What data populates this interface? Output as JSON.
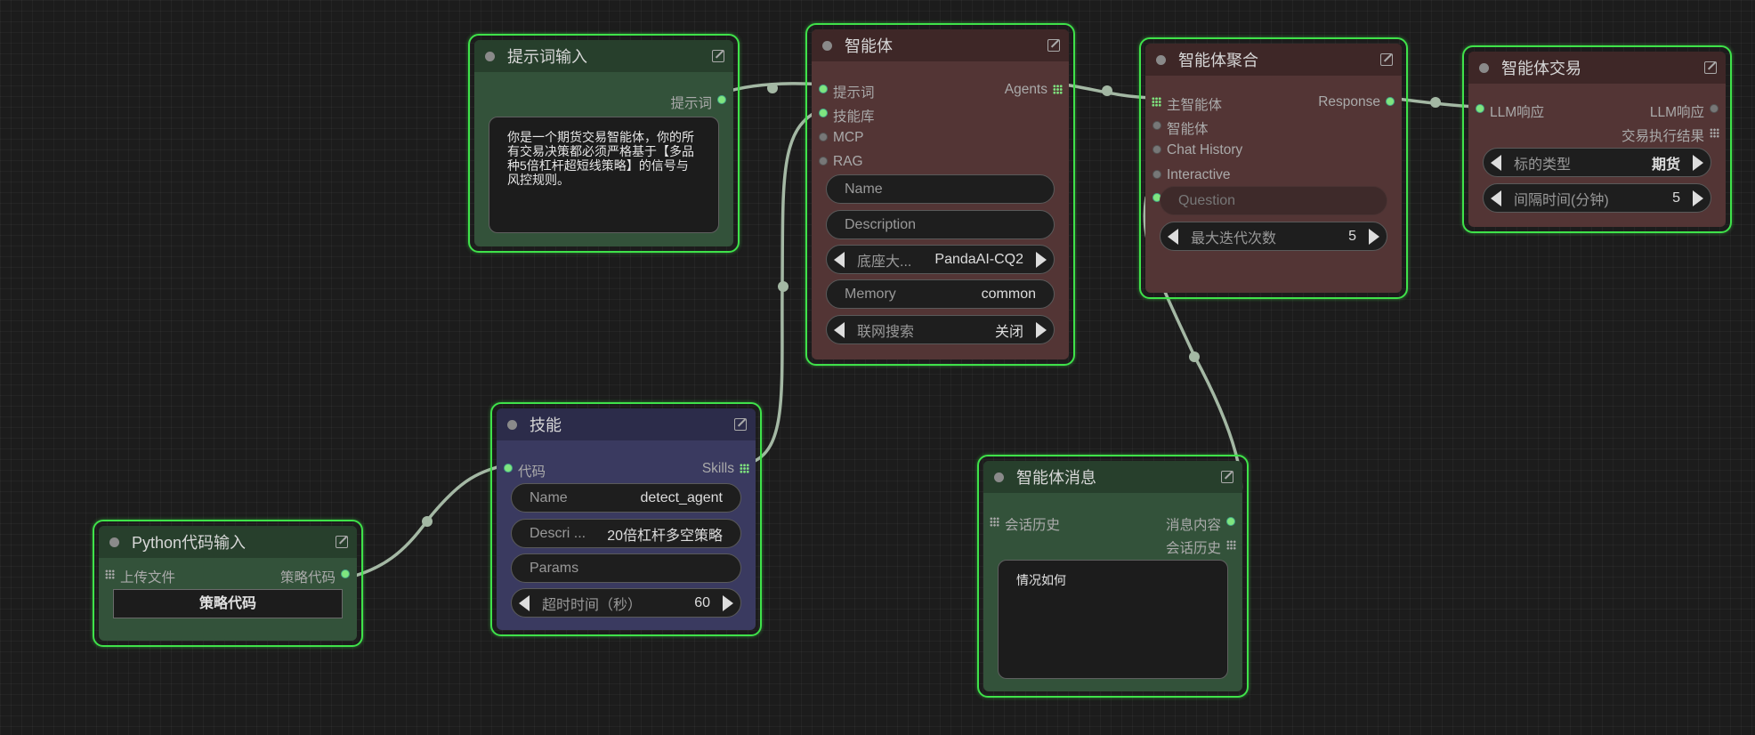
{
  "colors": {
    "accent": "#3fe24a",
    "wire": "#a4b8a4"
  },
  "nodes": {
    "prompt": {
      "title": "提示词输入",
      "output": "提示词",
      "text": "你是一个期货交易智能体，你的所有交易决策都必须严格基于【多品种5倍杠杆超短线策略】的信号与风控规则。"
    },
    "skill": {
      "title": "技能",
      "input": "代码",
      "output": "Skills",
      "name_label": "Name",
      "name_value": "detect_agent",
      "desc_label": "Descri ...",
      "desc_value": "20倍杠杆多空策略",
      "params_label": "Params",
      "timeout_label": "超时时间（秒）",
      "timeout_value": "60"
    },
    "python": {
      "title": "Python代码输入",
      "input": "上传文件",
      "output": "策略代码",
      "button": "策略代码"
    },
    "agent": {
      "title": "智能体",
      "inputs": [
        "提示词",
        "技能库",
        "MCP",
        "RAG"
      ],
      "output": "Agents",
      "name_placeholder": "Name",
      "desc_placeholder": "Description",
      "model_label": "底座大...",
      "model_value": "PandaAI-CQ2",
      "memory_label": "Memory",
      "memory_value": "common",
      "search_label": "联网搜索",
      "search_value": "关闭"
    },
    "aggregate": {
      "title": "智能体聚合",
      "inputs": [
        "主智能体",
        "智能体",
        "Chat History",
        "Interactive"
      ],
      "output": "Response",
      "question_placeholder": "Question",
      "iter_label": "最大迭代次数",
      "iter_value": "5"
    },
    "trade": {
      "title": "智能体交易",
      "input": "LLM响应",
      "outputs": [
        "LLM响应",
        "交易执行结果"
      ],
      "type_label": "标的类型",
      "type_value": "期货",
      "interval_label": "间隔时间(分钟)",
      "interval_value": "5"
    },
    "message": {
      "title": "智能体消息",
      "input": "会话历史",
      "outputs": [
        "消息内容",
        "会话历史"
      ],
      "text": "情况如何"
    }
  }
}
